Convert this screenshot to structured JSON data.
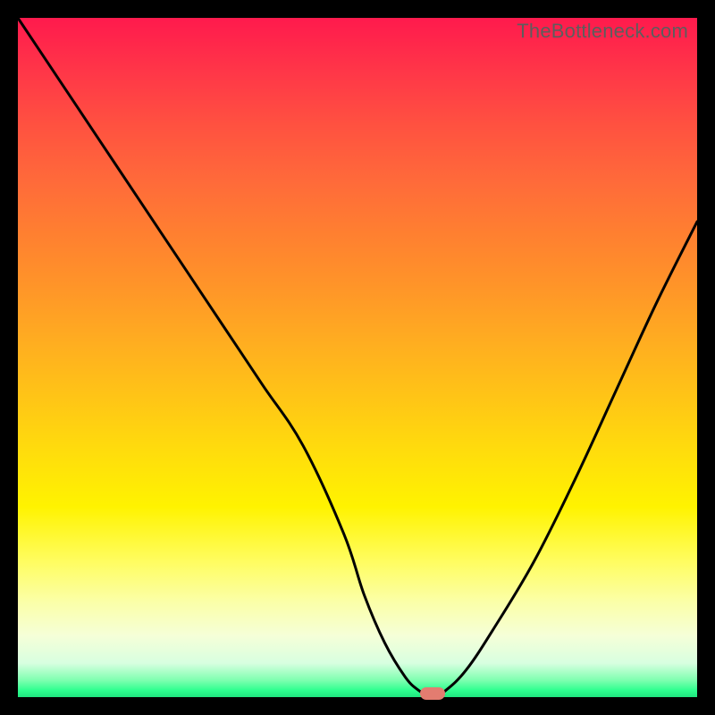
{
  "watermark": {
    "text": "TheBottleneck.com"
  },
  "chart_data": {
    "type": "line",
    "title": "",
    "xlabel": "",
    "ylabel": "",
    "xlim": [
      0,
      100
    ],
    "ylim": [
      0,
      100
    ],
    "grid": false,
    "series": [
      {
        "name": "bottleneck-curve",
        "x": [
          0,
          6,
          12,
          18,
          24,
          30,
          36,
          42,
          48,
          51,
          54,
          57,
          59,
          61,
          63,
          66,
          70,
          76,
          82,
          88,
          94,
          100
        ],
        "y": [
          100,
          91,
          82,
          73,
          64,
          55,
          46,
          37,
          24,
          15,
          8,
          3,
          1,
          0,
          1,
          4,
          10,
          20,
          32,
          45,
          58,
          70
        ]
      }
    ],
    "annotations": [
      {
        "name": "min-marker",
        "x": 61,
        "y": 0,
        "color": "#e37c70"
      }
    ],
    "colors": {
      "curve": "#000000",
      "marker": "#e37c70",
      "gradient_top": "#ff1a4d",
      "gradient_bottom": "#20e57f"
    }
  }
}
